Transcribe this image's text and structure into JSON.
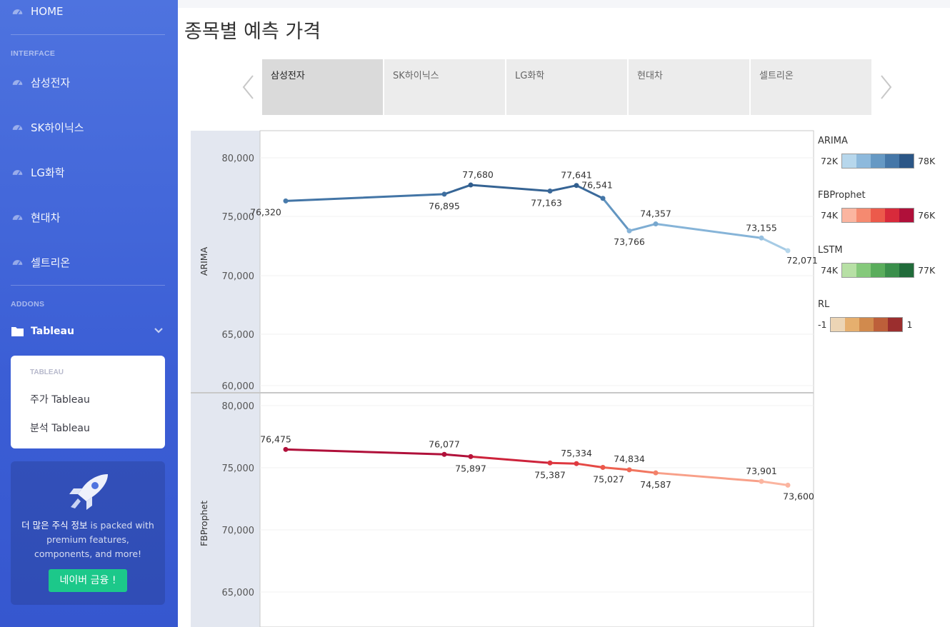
{
  "sidebar": {
    "home": "HOME",
    "interface_header": "INTERFACE",
    "items": [
      {
        "label": "삼성전자"
      },
      {
        "label": "SK하이닉스"
      },
      {
        "label": "LG화학"
      },
      {
        "label": "현대차"
      },
      {
        "label": "셀트리온"
      }
    ],
    "addons_header": "ADDONS",
    "tableau": "Tableau",
    "sub_header": "TABLEAU",
    "sub_items": [
      {
        "label": "주가 Tableau"
      },
      {
        "label": "분석 Tableau"
      }
    ],
    "promo": {
      "highlight": "더 많은 주식 정보",
      "text": " is packed with premium features, components, and more!",
      "button": "네이버 금융 !"
    }
  },
  "page": {
    "title": "종목별 예측 가격"
  },
  "tabs": [
    {
      "label": "삼성전자",
      "active": true
    },
    {
      "label": "SK하이닉스",
      "active": false
    },
    {
      "label": "LG화학",
      "active": false
    },
    {
      "label": "현대차",
      "active": false
    },
    {
      "label": "셀트리온",
      "active": false
    }
  ],
  "legend": [
    {
      "title": "ARIMA",
      "min": "72K",
      "max": "78K",
      "colors": [
        "#b7d7ec",
        "#8db9dc",
        "#6699c4",
        "#4577a8",
        "#2b5686"
      ]
    },
    {
      "title": "FBProphet",
      "min": "74K",
      "max": "76K",
      "colors": [
        "#fbb5a0",
        "#f58a70",
        "#ec5a4b",
        "#d82a3b",
        "#b0103a"
      ]
    },
    {
      "title": "LSTM",
      "min": "74K",
      "max": "77K",
      "colors": [
        "#b7e0a5",
        "#85c97b",
        "#5aad5c",
        "#3a8f4b",
        "#216b3a"
      ]
    },
    {
      "title": "RL",
      "min": "-1",
      "max": "1",
      "colors": [
        "#ecd5b5",
        "#e6af6e",
        "#d18a4d",
        "#bd5f3a",
        "#9b2e2e"
      ]
    }
  ],
  "chart_data": [
    {
      "type": "line",
      "row_label": "ARIMA",
      "y_ticks": [
        "80,000",
        "75,000",
        "70,000",
        "65,000",
        "60,000"
      ],
      "ylim": [
        60000,
        81000
      ],
      "x": [
        0,
        6,
        7,
        10,
        11,
        12,
        13,
        14,
        18,
        19
      ],
      "values": [
        76320,
        76895,
        77680,
        77163,
        77641,
        76541,
        73766,
        74357,
        73155,
        72071
      ],
      "labels": [
        "76,320",
        "76,895",
        "77,680",
        "77,163",
        "77,641",
        "76,541",
        "73,766",
        "74,357",
        "73,155",
        "72,071"
      ]
    },
    {
      "type": "line",
      "row_label": "FBProphet",
      "y_ticks": [
        "80,000",
        "75,000",
        "70,000",
        "65,000"
      ],
      "ylim": [
        62500,
        81000
      ],
      "x": [
        0,
        6,
        7,
        10,
        11,
        12,
        13,
        14,
        18,
        19
      ],
      "values": [
        76475,
        76077,
        75897,
        75387,
        75334,
        75027,
        74834,
        74587,
        73901,
        73600
      ],
      "labels": [
        "76,475",
        "76,077",
        "75,897",
        "75,387",
        "75,334",
        "75,027",
        "74,834",
        "74,587",
        "73,901",
        "73,600"
      ]
    }
  ]
}
